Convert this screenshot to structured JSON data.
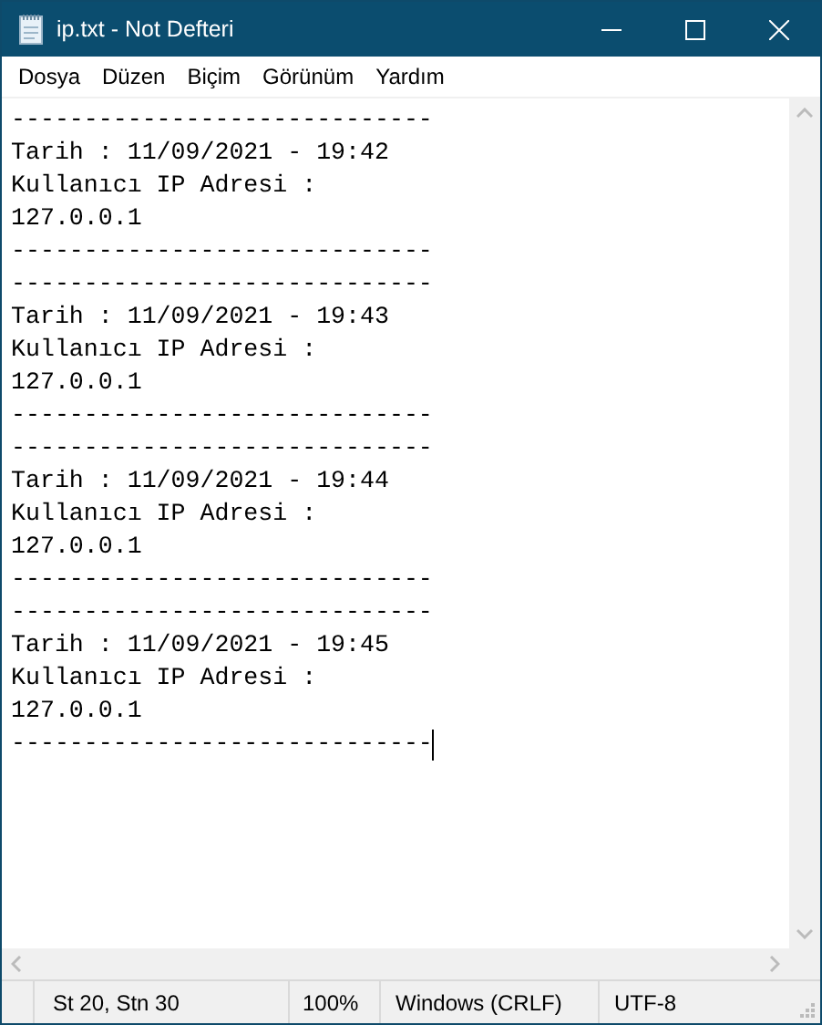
{
  "window": {
    "title": "ip.txt - Not Defteri"
  },
  "menu": [
    "Dosya",
    "Düzen",
    "Biçim",
    "Görünüm",
    "Yardım"
  ],
  "editor": {
    "lines": [
      "-----------------------------",
      "Tarih : 11/09/2021 - 19:42",
      "Kullanıcı IP Adresi :",
      "127.0.0.1",
      "-----------------------------",
      "-----------------------------",
      "Tarih : 11/09/2021 - 19:43",
      "Kullanıcı IP Adresi :",
      "127.0.0.1",
      "-----------------------------",
      "-----------------------------",
      "Tarih : 11/09/2021 - 19:44",
      "Kullanıcı IP Adresi :",
      "127.0.0.1",
      "-----------------------------",
      "-----------------------------",
      "Tarih : 11/09/2021 - 19:45",
      "Kullanıcı IP Adresi :",
      "127.0.0.1",
      "-----------------------------"
    ]
  },
  "status_bar": {
    "position": "St 20, Stn 30",
    "zoom": "100%",
    "line_ending": "Windows (CRLF)",
    "encoding": "UTF-8"
  }
}
